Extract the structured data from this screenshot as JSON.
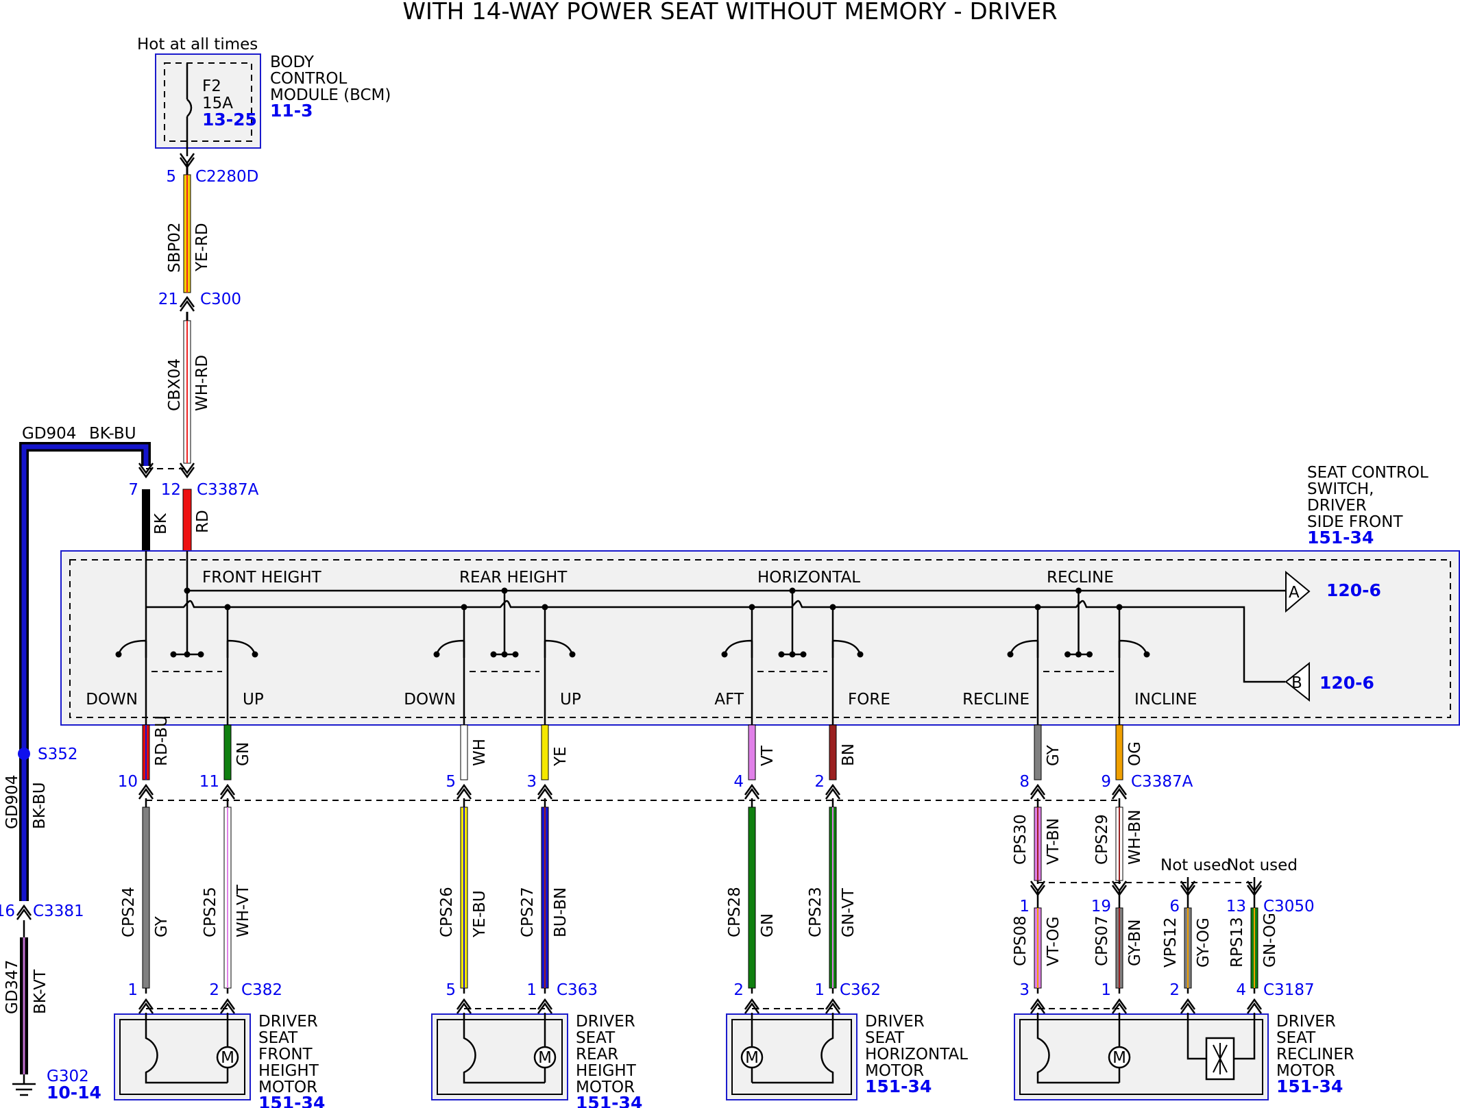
{
  "title": "WITH 14-WAY POWER SEAT WITHOUT MEMORY - DRIVER",
  "colors": {
    "frame_blue": "#1a1acc",
    "label_blue": "#0000ee",
    "box_fill": "#f1f1f1"
  },
  "bcm": {
    "supply_note": "Hot at all times",
    "name_lines": [
      "BODY",
      "CONTROL",
      "MODULE (BCM)"
    ],
    "ref": "11-3",
    "fuse_name": "F2",
    "fuse_rating": "15A",
    "fuse_ref": "13-25"
  },
  "connectors": {
    "c2280d": "C2280D",
    "c2280d_pin": "5",
    "c300": "C300",
    "c300_pin": "21",
    "c3387a_top": "C3387A",
    "c3387a_bottom": "C3387A",
    "c3381": "C3381",
    "c3381_pin": "16",
    "c3050": "C3050",
    "c382": "C382",
    "c363": "C363",
    "c362": "C362",
    "c3187": "C3187",
    "pin7": "7",
    "pin12": "12"
  },
  "wires": {
    "sbp02": {
      "circuit": "SBP02",
      "color": "YE-RD"
    },
    "cbx04": {
      "circuit": "CBX04",
      "color": "WH-RD"
    },
    "gd904_top": {
      "circuit": "GD904",
      "color": "BK-BU"
    },
    "gd904_side": {
      "circuit": "GD904",
      "color": "BK-BU"
    },
    "gd347": {
      "circuit": "GD347",
      "color": "BK-VT"
    },
    "bk": "BK",
    "rd": "RD"
  },
  "splice": {
    "name": "S352"
  },
  "ground": {
    "name": "G302",
    "ref": "10-14"
  },
  "switch": {
    "name_lines": [
      "SEAT CONTROL",
      "SWITCH,",
      "DRIVER",
      "SIDE FRONT"
    ],
    "ref": "151-34",
    "sections": [
      "FRONT HEIGHT",
      "REAR HEIGHT",
      "HORIZONTAL",
      "RECLINE"
    ],
    "positions": [
      "DOWN",
      "UP",
      "DOWN",
      "UP",
      "AFT",
      "FORE",
      "RECLINE",
      "INCLINE"
    ],
    "offpage_a": {
      "letter": "A",
      "ref": "120-6"
    },
    "offpage_b": {
      "letter": "B",
      "ref": "120-6"
    }
  },
  "outputs": [
    {
      "color": "RD-BU",
      "pin": "10",
      "circuit": "CPS24",
      "circuit_color": "GY",
      "motor_pin": "1"
    },
    {
      "color": "GN",
      "pin": "11",
      "circuit": "CPS25",
      "circuit_color": "WH-VT",
      "motor_pin": "2"
    },
    {
      "color": "WH",
      "pin": "5",
      "circuit": "CPS26",
      "circuit_color": "YE-BU",
      "motor_pin": "5"
    },
    {
      "color": "YE",
      "pin": "3",
      "circuit": "CPS27",
      "circuit_color": "BU-BN",
      "motor_pin": "1"
    },
    {
      "color": "VT",
      "pin": "4",
      "circuit": "CPS28",
      "circuit_color": "GN",
      "motor_pin": "2"
    },
    {
      "color": "BN",
      "pin": "2",
      "circuit": "CPS23",
      "circuit_color": "GN-VT",
      "motor_pin": "1"
    },
    {
      "color": "GY",
      "pin": "8",
      "circuit": "CPS30",
      "circuit_color": "VT-BN",
      "mid_pin": "1",
      "circuit2": "CPS08",
      "circuit2_color": "VT-OG",
      "motor_pin": "3"
    },
    {
      "color": "OG",
      "pin": "9",
      "circuit": "CPS29",
      "circuit_color": "WH-BN",
      "mid_pin": "19",
      "circuit2": "CPS07",
      "circuit2_color": "GY-BN",
      "motor_pin": "1"
    }
  ],
  "recliner_extra": [
    {
      "note": "Not used",
      "mid_pin": "6",
      "circuit": "VPS12",
      "circuit_color": "GY-OG",
      "motor_pin": "2"
    },
    {
      "note": "Not used",
      "mid_pin": "13",
      "circuit": "RPS13",
      "circuit_color": "GN-OG",
      "motor_pin": "4"
    }
  ],
  "motors": [
    {
      "lines": [
        "DRIVER",
        "SEAT",
        "FRONT",
        "HEIGHT",
        "MOTOR"
      ],
      "ref": "151-34"
    },
    {
      "lines": [
        "DRIVER",
        "SEAT",
        "REAR",
        "HEIGHT",
        "MOTOR"
      ],
      "ref": "151-34"
    },
    {
      "lines": [
        "DRIVER",
        "SEAT",
        "HORIZONTAL",
        "MOTOR"
      ],
      "ref": "151-34"
    },
    {
      "lines": [
        "DRIVER",
        "SEAT",
        "RECLINER",
        "MOTOR"
      ],
      "ref": "151-34"
    }
  ],
  "motor_symbol": "M"
}
